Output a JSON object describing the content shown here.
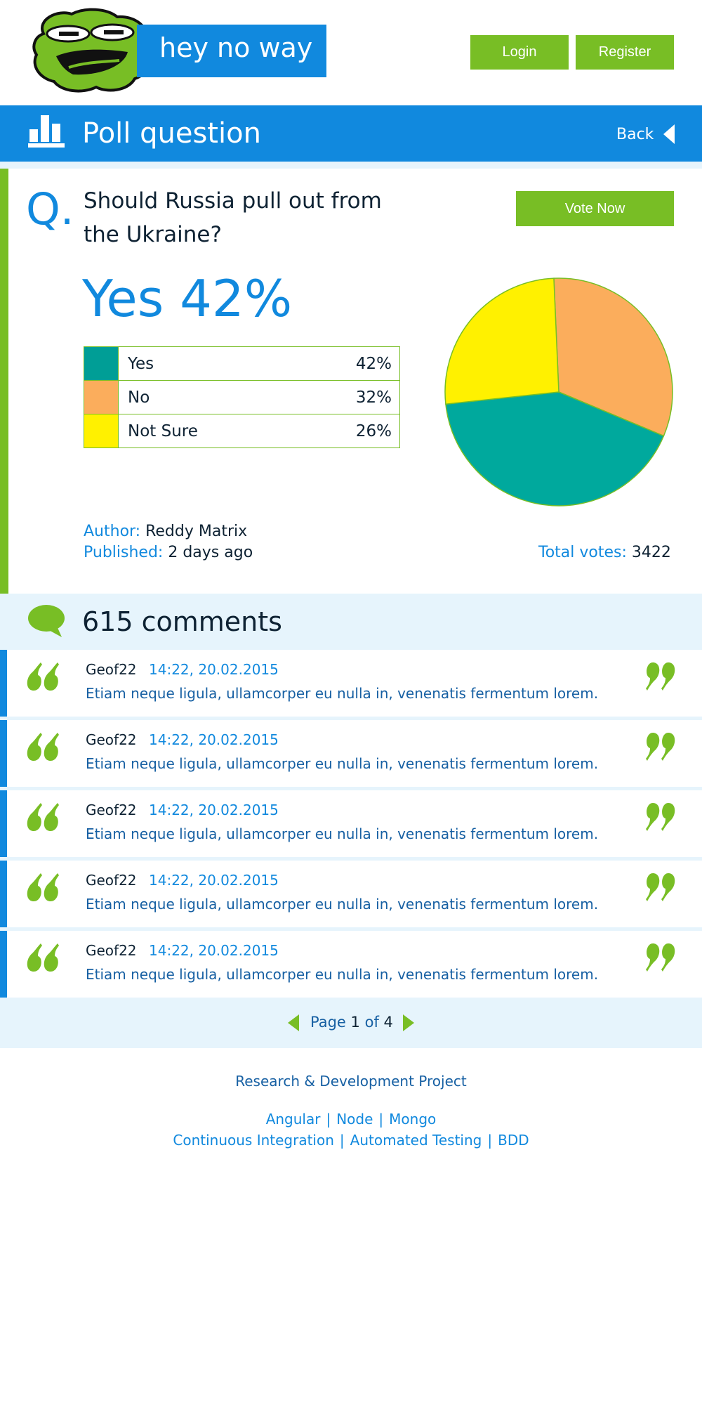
{
  "header": {
    "brand": "hey no way",
    "login_label": "Login",
    "register_label": "Register"
  },
  "title_bar": {
    "title": "Poll question",
    "back_label": "Back"
  },
  "question": {
    "marker": "Q.",
    "text": "Should Russia pull out from the Ukraine?",
    "vote_label": "Vote Now",
    "headline": "Yes 42%",
    "options": [
      {
        "label": "Yes",
        "percent": "42%",
        "color": "#009e96"
      },
      {
        "label": "No",
        "percent": "32%",
        "color": "#fbad5c"
      },
      {
        "label": "Not Sure",
        "percent": "26%",
        "color": "#fff100"
      }
    ],
    "author_key": "Author:",
    "author": "Reddy Matrix",
    "published_key": "Published:",
    "published": "2 days ago",
    "total_key": "Total votes:",
    "total": "3422"
  },
  "chart_data": {
    "type": "pie",
    "categories": [
      "Yes",
      "No",
      "Not Sure"
    ],
    "values": [
      42,
      32,
      26
    ],
    "colors": [
      "#00a99d",
      "#fbad5c",
      "#fff100"
    ]
  },
  "comments": {
    "count_label": "615 comments",
    "items": [
      {
        "author": "Geof22",
        "time": "14:22, 20.02.2015",
        "text": "Etiam neque ligula, ullamcorper eu nulla in, venenatis fermentum lorem."
      },
      {
        "author": "Geof22",
        "time": "14:22, 20.02.2015",
        "text": "Etiam neque ligula, ullamcorper eu nulla in, venenatis fermentum lorem."
      },
      {
        "author": "Geof22",
        "time": "14:22, 20.02.2015",
        "text": "Etiam neque ligula, ullamcorper eu nulla in, venenatis fermentum lorem."
      },
      {
        "author": "Geof22",
        "time": "14:22, 20.02.2015",
        "text": "Etiam neque ligula, ullamcorper eu nulla in, venenatis fermentum lorem."
      },
      {
        "author": "Geof22",
        "time": "14:22, 20.02.2015",
        "text": "Etiam neque ligula, ullamcorper eu nulla in, venenatis fermentum lorem."
      }
    ]
  },
  "pager": {
    "prefix": "Page",
    "current": "1",
    "of": "of",
    "total": "4"
  },
  "footer": {
    "title": "Research & Development Project",
    "tech_links": [
      "Angular",
      "Node",
      "Mongo"
    ],
    "process_links": [
      "Continuous Integration",
      "Automated Testing",
      "BDD"
    ],
    "separator": "|"
  },
  "colors": {
    "brand_blue": "#1189de",
    "accent_green": "#78be25",
    "pale_blue": "#e6f4fc"
  }
}
